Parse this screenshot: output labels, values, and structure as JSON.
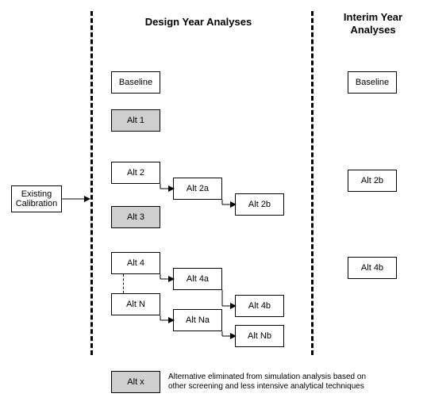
{
  "titles": {
    "design": "Design Year Analyses",
    "interim": "Interim Year Analyses"
  },
  "input": {
    "existing_calibration": "Existing Calibration"
  },
  "design": {
    "baseline": "Baseline",
    "alt1": "Alt 1",
    "alt2": "Alt 2",
    "alt2a": "Alt 2a",
    "alt2b": "Alt 2b",
    "alt3": "Alt 3",
    "alt4": "Alt 4",
    "alt4a": "Alt 4a",
    "alt4b": "Alt 4b",
    "altN": "Alt N",
    "altNa": "Alt Na",
    "altNb": "Alt Nb"
  },
  "interim": {
    "baseline": "Baseline",
    "alt2b": "Alt 2b",
    "alt4b": "Alt 4b"
  },
  "legend": {
    "altx": "Alt x",
    "text": "Alternative eliminated from simulation analysis based on other screening and less intensive analytical techniques"
  }
}
